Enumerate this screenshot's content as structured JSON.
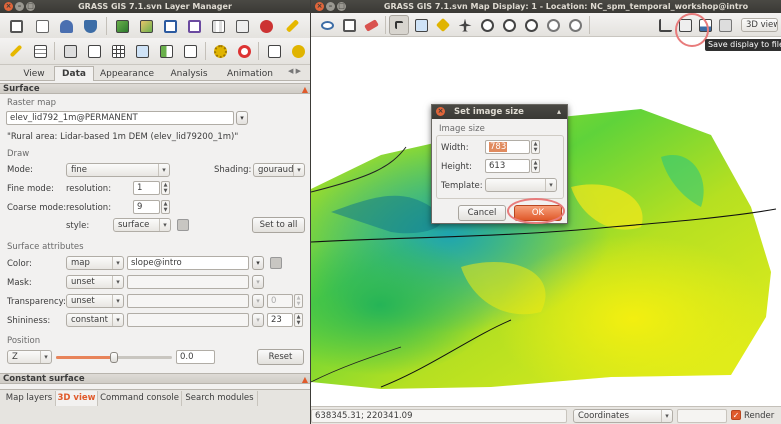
{
  "layer_manager": {
    "title": "GRASS GIS 7.1.svn Layer Manager",
    "tabs": [
      "View",
      "Data",
      "Appearance",
      "Analysis",
      "Animation"
    ],
    "active_tab": "Data",
    "tabs_scroll": "◀ ▶",
    "surface_header": "Surface",
    "raster_map_label": "Raster map",
    "raster_map_value": "elev_lid792_1m@PERMANENT",
    "raster_description": "\"Rural area: Lidar-based 1m DEM (elev_lid79200_1m)\"",
    "draw_label": "Draw",
    "mode_label": "Mode:",
    "mode_value": "fine",
    "shading_label": "Shading:",
    "shading_value": "gouraud",
    "fine_mode_label": "Fine mode:",
    "fine_resolution_label": "resolution:",
    "fine_resolution_value": "1",
    "coarse_mode_label": "Coarse mode:",
    "coarse_resolution_label": "resolution:",
    "coarse_resolution_value": "9",
    "style_label": "style:",
    "style_value": "surface",
    "set_to_all": "Set to all",
    "surface_attributes_label": "Surface attributes",
    "color_label": "Color:",
    "color_mode": "map",
    "color_value": "slope@intro",
    "mask_label": "Mask:",
    "mask_mode": "unset",
    "transparency_label": "Transparency:",
    "transparency_mode": "unset",
    "transparency_value": "0",
    "shininess_label": "Shininess:",
    "shininess_mode": "constant",
    "shininess_value": "23",
    "position_label": "Position",
    "position_axis": "Z",
    "position_value": "0.0",
    "position_slider_fraction": 0.5,
    "reset": "Reset",
    "constant_surface_header": "Constant surface",
    "bottom_tabs": [
      "Map layers",
      "3D view",
      "Command console",
      "Search modules"
    ],
    "active_bottom_tab": "3D view"
  },
  "map_display": {
    "title": "GRASS GIS 7.1.svn Map Display: 1 - Location: NC_spm_temporal_workshop@intro",
    "view_mode": "3D view",
    "tooltip": "Save display to file",
    "coordinates": "638345.31; 220341.09",
    "coords_mode": "Coordinates",
    "render_label": "Render",
    "render_checked": true
  },
  "dialog": {
    "title": "Set image size",
    "group_label": "Image size",
    "width_label": "Width:",
    "width_value": "783",
    "height_label": "Height:",
    "height_value": "613",
    "template_label": "Template:",
    "cancel": "Cancel",
    "ok": "OK"
  },
  "colors": {
    "accent": "#e05a2b",
    "highlight": "#e87b7b",
    "titlebar": "#3c3b37"
  }
}
